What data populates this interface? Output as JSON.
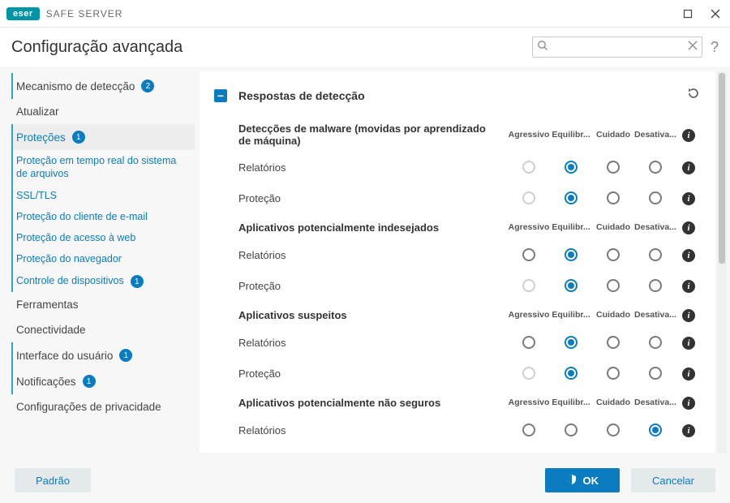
{
  "brand": {
    "badge": "eser",
    "product": "SAFE SERVER"
  },
  "page_title": "Configuração avançada",
  "search": {
    "placeholder": ""
  },
  "sidebar": {
    "items": [
      {
        "label": "Mecanismo de detecção",
        "badge": "2",
        "top": true,
        "accent": true
      },
      {
        "label": "Atualizar",
        "top": true
      },
      {
        "label": "Proteções",
        "badge": "1",
        "top": true,
        "active": true,
        "accent": true
      },
      {
        "label": "Ferramentas",
        "top": true
      },
      {
        "label": "Conectividade",
        "top": true
      },
      {
        "label": "Interface do usuário",
        "badge": "1",
        "top": true,
        "accent": true
      },
      {
        "label": "Notificações",
        "badge": "1",
        "top": true,
        "accent": true
      },
      {
        "label": "Configurações de privacidade",
        "top": true
      }
    ],
    "subs": [
      {
        "label": "Proteção em tempo real do sistema de arquivos"
      },
      {
        "label": "SSL/TLS"
      },
      {
        "label": "Proteção do cliente de e-mail"
      },
      {
        "label": "Proteção de acesso à web"
      },
      {
        "label": "Proteção do navegador"
      },
      {
        "label": "Controle de dispositivos",
        "badge": "1"
      }
    ]
  },
  "columns": [
    "Agressivo",
    "Equilibr...",
    "Cuidado",
    "Desativa..."
  ],
  "section": {
    "title": "Respostas de detecção"
  },
  "groups": [
    {
      "title": "Detecções de malware (movidas por aprendizado de máquina)",
      "rows": [
        {
          "label": "Relatórios",
          "disabled": [
            0
          ],
          "selected": 1
        },
        {
          "label": "Proteção",
          "disabled": [
            0
          ],
          "selected": 1
        }
      ]
    },
    {
      "title": "Aplicativos potencialmente indesejados",
      "rows": [
        {
          "label": "Relatórios",
          "disabled": [],
          "selected": 1
        },
        {
          "label": "Proteção",
          "disabled": [
            0
          ],
          "selected": 1
        }
      ]
    },
    {
      "title": "Aplicativos suspeitos",
      "rows": [
        {
          "label": "Relatórios",
          "disabled": [],
          "selected": 1
        },
        {
          "label": "Proteção",
          "disabled": [
            0
          ],
          "selected": 1
        }
      ]
    },
    {
      "title": "Aplicativos potencialmente não seguros",
      "rows": [
        {
          "label": "Relatórios",
          "disabled": [],
          "selected": 3
        }
      ]
    }
  ],
  "footer": {
    "default": "Padrão",
    "ok": "OK",
    "cancel": "Cancelar"
  }
}
